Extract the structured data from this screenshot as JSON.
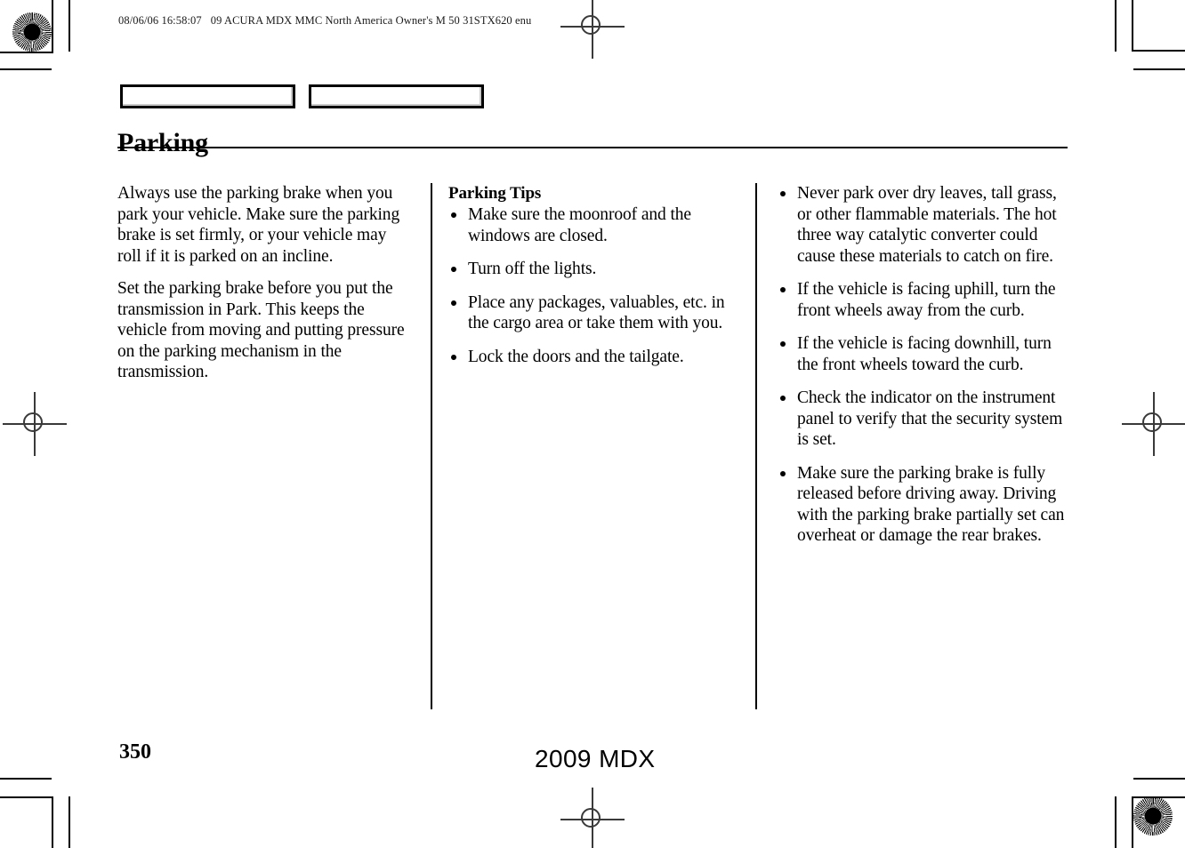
{
  "header": {
    "timestamp": "08/06/06 16:58:07",
    "job_info": "09 ACURA MDX MMC North America Owner's M 50 31STX620 enu"
  },
  "chapter": {
    "title": "Parking",
    "tab_boxes": [
      "",
      ""
    ]
  },
  "columns": {
    "col1": {
      "paragraphs": [
        "Always use the parking brake when you park your vehicle. Make sure the parking brake is set firmly, or your vehicle may roll if it is parked on an incline.",
        "Set the parking brake before you put the transmission in Park. This keeps the vehicle from moving and putting pressure on the parking mechanism in the transmission."
      ]
    },
    "col2": {
      "heading": "Parking Tips",
      "bullets": [
        "Make sure the moonroof and the windows are closed.",
        "Turn off the lights.",
        "Place any packages, valuables, etc. in the cargo area or take them with you.",
        "Lock the doors and the tailgate."
      ]
    },
    "col3": {
      "bullets": [
        "Never park over dry leaves, tall grass, or other flammable materials. The hot three way catalytic converter could cause these materials to catch on fire.",
        "If the vehicle is facing uphill, turn the front wheels away from the curb.",
        "If the vehicle is facing downhill, turn the front wheels toward the curb.",
        "Check the indicator on the instrument panel to verify that the security system is set.",
        "Make sure the parking brake is fully released before driving away. Driving with the parking brake partially set can overheat or damage the rear brakes."
      ]
    }
  },
  "footer": {
    "page_number": "350",
    "model_year": "2009  MDX"
  },
  "colors": {
    "text": "#000000",
    "rule": "#000000",
    "registration": "#3a3a3a",
    "background": "#ffffff"
  }
}
